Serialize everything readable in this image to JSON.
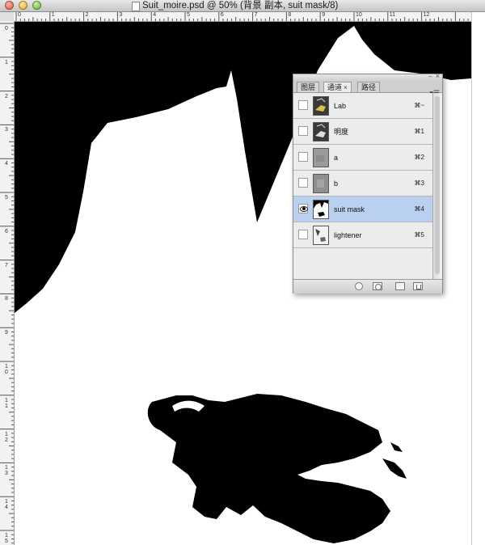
{
  "window": {
    "title": "Suit_moire.psd @ 50% (背景 副本, suit mask/8)"
  },
  "rulers": {
    "horizontal_labels": [
      "0",
      "1",
      "2",
      "3",
      "4",
      "5",
      "6",
      "7",
      "8",
      "9",
      "10",
      "11",
      "12"
    ],
    "vertical_labels": [
      "0",
      "1",
      "2",
      "3",
      "4",
      "5",
      "6",
      "7",
      "8",
      "9",
      "10",
      "11",
      "12",
      "13",
      "14",
      "15"
    ]
  },
  "panel": {
    "tabs": [
      {
        "label": "图层",
        "active": false
      },
      {
        "label": "通道",
        "active": true
      },
      {
        "label": "路径",
        "active": false
      }
    ],
    "tab_close": "×",
    "minimize": "–",
    "close": "×",
    "menu_glyph": "▾☰",
    "channels": [
      {
        "name": "Lab",
        "shortcut": "⌘~",
        "visible": false,
        "selected": false,
        "thumb": "lab-thumbnail"
      },
      {
        "name": "明度",
        "shortcut": "⌘1",
        "visible": false,
        "selected": false,
        "thumb": "lightness-thumbnail"
      },
      {
        "name": "a",
        "shortcut": "⌘2",
        "visible": false,
        "selected": false,
        "thumb": "gray-thumbnail"
      },
      {
        "name": "b",
        "shortcut": "⌘3",
        "visible": false,
        "selected": false,
        "thumb": "gray-thumbnail"
      },
      {
        "name": "suit mask",
        "shortcut": "⌘4",
        "visible": true,
        "selected": true,
        "thumb": "mask-thumbnail"
      },
      {
        "name": "lightener",
        "shortcut": "⌘5",
        "visible": false,
        "selected": false,
        "thumb": "lightener-thumbnail"
      }
    ],
    "bottom_buttons": [
      "load-selection-icon",
      "save-selection-icon",
      "new-channel-icon",
      "trash-icon"
    ],
    "colors": {
      "selected_row": "#b9d0f0",
      "panel_bg": "#ececec"
    }
  }
}
